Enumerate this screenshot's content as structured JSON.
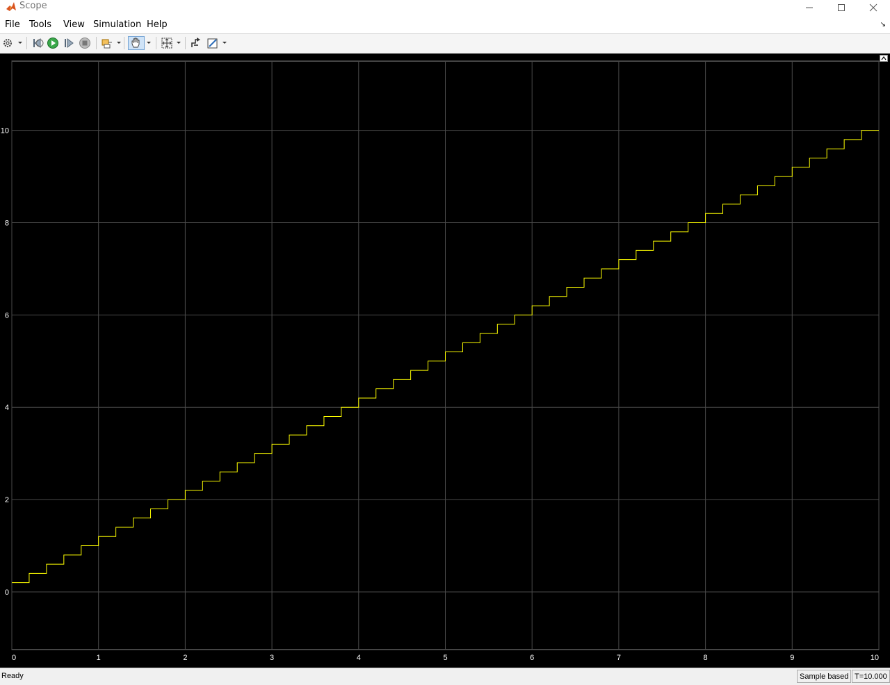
{
  "window": {
    "title": "Scope"
  },
  "menu": [
    "File",
    "Tools",
    "View",
    "Simulation",
    "Help"
  ],
  "toolbar": {
    "buttons": [
      "settings-icon",
      "step-back-icon",
      "run-icon",
      "step-forward-icon",
      "stop-icon",
      "highlight-block-icon",
      "pan-icon",
      "zoom-fit-icon",
      "signal-select-icon",
      "style-edit-icon"
    ]
  },
  "status": {
    "ready": "Ready",
    "mode": "Sample based",
    "time": "T=10.000"
  },
  "colors": {
    "plot_bg": "#000000",
    "grid": "#4a4a4a",
    "signal": "#ffff00",
    "text": "#ffffff"
  },
  "chart_data": {
    "type": "line",
    "step": true,
    "xlim": [
      0,
      10
    ],
    "ylim": [
      -1.25,
      11.5
    ],
    "xticks": [
      0,
      1,
      2,
      3,
      4,
      5,
      6,
      7,
      8,
      9,
      10
    ],
    "yticks": [
      0,
      2,
      4,
      6,
      8,
      10
    ],
    "grid": true,
    "series": [
      {
        "color": "#ffff00",
        "x": [
          0,
          0.2,
          0.4,
          0.6,
          0.8,
          1.0,
          1.2,
          1.4,
          1.6,
          1.8,
          2.0,
          2.2,
          2.4,
          2.6,
          2.8,
          3.0,
          3.2,
          3.4,
          3.6,
          3.8,
          4.0,
          4.2,
          4.4,
          4.6,
          4.8,
          5.0,
          5.2,
          5.4,
          5.6,
          5.8,
          6.0,
          6.2,
          6.4,
          6.6,
          6.8,
          7.0,
          7.2,
          7.4,
          7.6,
          7.8,
          8.0,
          8.2,
          8.4,
          8.6,
          8.8,
          9.0,
          9.2,
          9.4,
          9.6,
          9.8,
          10.0
        ],
        "y": [
          0.2,
          0.4,
          0.6,
          0.8,
          1.0,
          1.2,
          1.4,
          1.6,
          1.8,
          2.0,
          2.2,
          2.4,
          2.6,
          2.8,
          3.0,
          3.2,
          3.4,
          3.6,
          3.8,
          4.0,
          4.2,
          4.4,
          4.6,
          4.8,
          5.0,
          5.2,
          5.4,
          5.6,
          5.8,
          6.0,
          6.2,
          6.4,
          6.6,
          6.8,
          7.0,
          7.2,
          7.4,
          7.6,
          7.8,
          8.0,
          8.2,
          8.4,
          8.6,
          8.8,
          9.0,
          9.2,
          9.4,
          9.6,
          9.8,
          10.0,
          10.0
        ]
      }
    ]
  }
}
